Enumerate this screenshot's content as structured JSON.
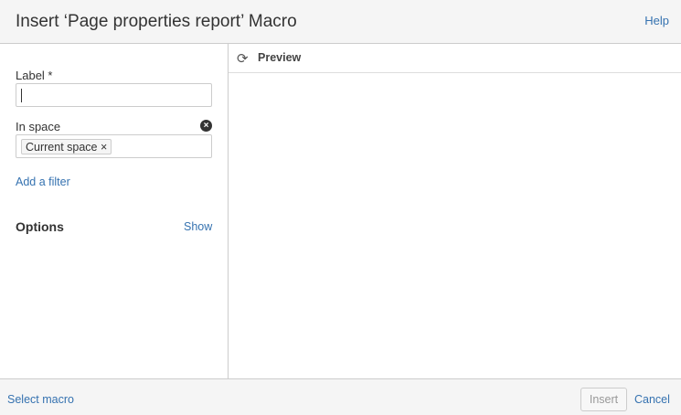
{
  "header": {
    "title": "Insert ‘Page properties report’ Macro",
    "help": "Help"
  },
  "form": {
    "label_label": "Label *",
    "label_value": "",
    "space_label": "In space",
    "space_chip": "Current space",
    "chip_remove": "×",
    "clear": "×",
    "add_filter": "Add a filter",
    "options": "Options",
    "show": "Show"
  },
  "preview": {
    "title": "Preview",
    "refresh_icon": "⟳"
  },
  "footer": {
    "select_macro": "Select macro",
    "insert": "Insert",
    "cancel": "Cancel"
  }
}
